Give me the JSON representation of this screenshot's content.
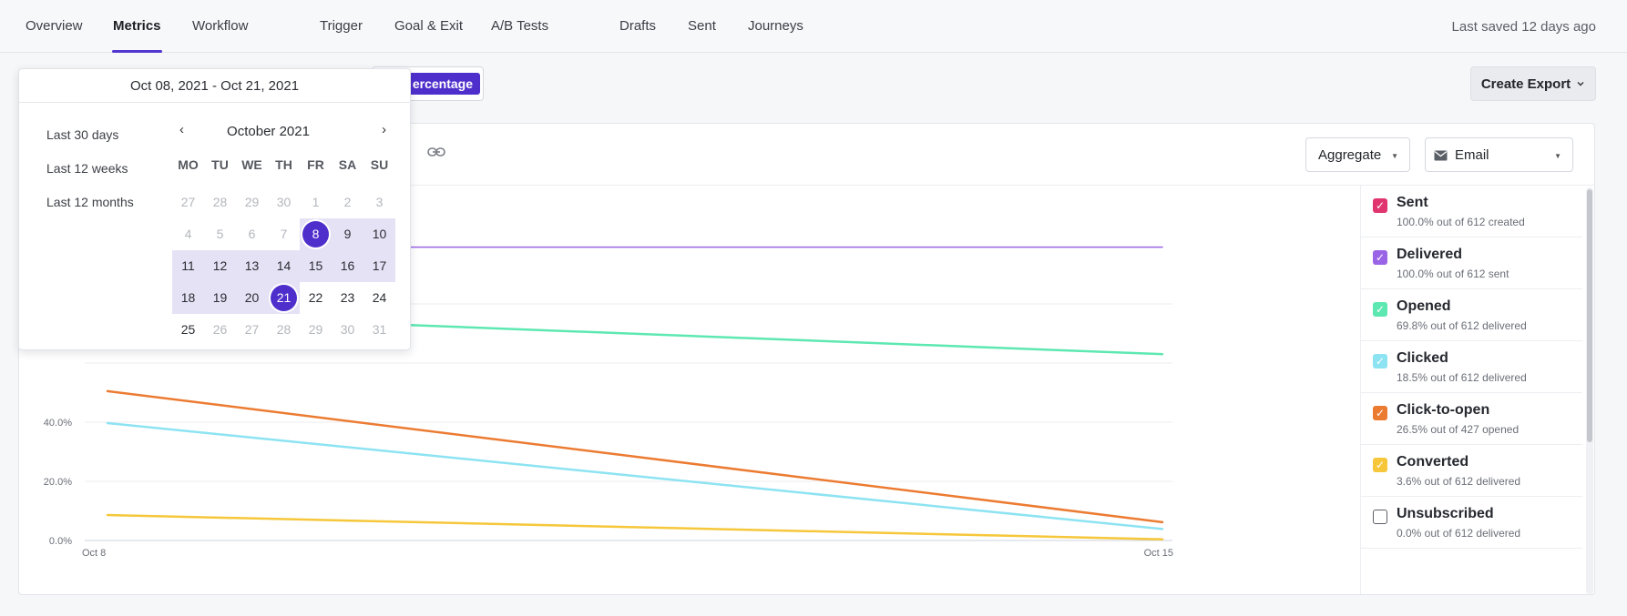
{
  "nav": {
    "tabs": [
      {
        "label": "Overview"
      },
      {
        "label": "Metrics"
      },
      {
        "label": "Workflow"
      },
      {
        "label": "Trigger"
      },
      {
        "label": "Goal & Exit"
      },
      {
        "label": "A/B Tests"
      },
      {
        "label": "Drafts"
      },
      {
        "label": "Sent"
      },
      {
        "label": "Journeys"
      }
    ],
    "active_index": 1,
    "last_saved": "Last saved 12 days ago"
  },
  "toolbar": {
    "mode_selected": "Percentage",
    "mode_visible_text": "ercentage",
    "create_export": "Create Export",
    "aggregate": "Aggregate",
    "channel": "Email",
    "link_icon": "link-icon",
    "channel_icon": "envelope-icon"
  },
  "datepicker": {
    "range": "Oct 08, 2021 - Oct 21, 2021",
    "presets": [
      "Last 30 days",
      "Last 12 weeks",
      "Last 12 months"
    ],
    "month": "October 2021",
    "prev": "‹",
    "next": "›",
    "weekdays": [
      "MO",
      "TU",
      "WE",
      "TH",
      "FR",
      "SA",
      "SU"
    ],
    "weeks": [
      [
        27,
        28,
        29,
        30,
        1,
        2,
        3
      ],
      [
        4,
        5,
        6,
        7,
        8,
        9,
        10
      ],
      [
        11,
        12,
        13,
        14,
        15,
        16,
        17
      ],
      [
        18,
        19,
        20,
        21,
        22,
        23,
        24
      ],
      [
        25,
        26,
        27,
        28,
        29,
        30,
        31
      ]
    ],
    "start_day": 8,
    "end_day": 21
  },
  "colors": {
    "accent": "#4f2fcc",
    "sent": "#e0356f",
    "delivered": "#9a64e6",
    "opened": "#5de8b2",
    "clicked": "#8de3f2",
    "click_to_open": "#ec7b32",
    "converted": "#f6c73a"
  },
  "legend": [
    {
      "name": "Sent",
      "sub": "100.0% out of 612 created",
      "color": "#e0356f",
      "checked": true
    },
    {
      "name": "Delivered",
      "sub": "100.0% out of 612 sent",
      "color": "#9a64e6",
      "checked": true
    },
    {
      "name": "Opened",
      "sub": "69.8% out of 612 delivered",
      "color": "#5de8b2",
      "checked": true
    },
    {
      "name": "Clicked",
      "sub": "18.5% out of 612 delivered",
      "color": "#8de3f2",
      "checked": true
    },
    {
      "name": "Click-to-open",
      "sub": "26.5% out of 427 opened",
      "color": "#ec7b32",
      "checked": true
    },
    {
      "name": "Converted",
      "sub": "3.6% out of 612 delivered",
      "color": "#f6c73a",
      "checked": true
    },
    {
      "name": "Unsubscribed",
      "sub": "0.0% out of 612 delivered",
      "color": "#5d6068",
      "checked": false
    }
  ],
  "chart_data": {
    "type": "line",
    "x": [
      "Oct 8",
      "Oct 15"
    ],
    "yticks": [
      "0.0%",
      "20.0%",
      "40.0%"
    ],
    "ylim": [
      0,
      100
    ],
    "grid": true,
    "series": [
      {
        "name": "Delivered",
        "color": "#9a64e6",
        "values": [
          99.2,
          99.2
        ]
      },
      {
        "name": "Opened",
        "color": "#5de8b2",
        "values": [
          76.8,
          63.0
        ]
      },
      {
        "name": "Click-to-open",
        "color": "#ec7b32",
        "values": [
          50.5,
          6.2
        ]
      },
      {
        "name": "Clicked",
        "color": "#8de3f2",
        "values": [
          39.7,
          3.9
        ]
      },
      {
        "name": "Converted",
        "color": "#f6c73a",
        "values": [
          8.6,
          0.4
        ]
      }
    ]
  }
}
